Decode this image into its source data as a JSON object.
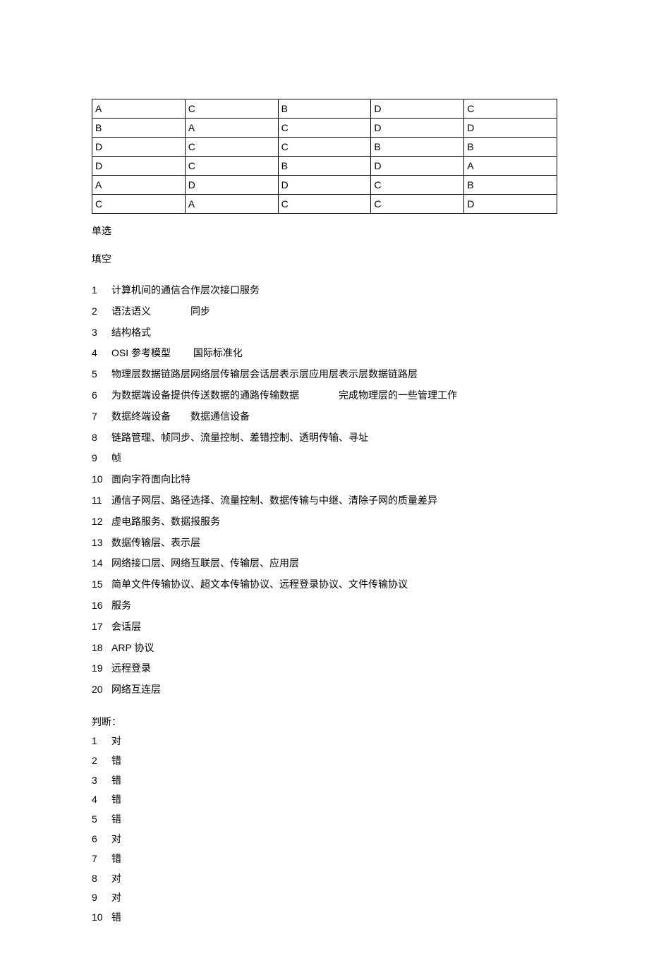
{
  "table": {
    "rows": [
      [
        "A",
        "C",
        "B",
        "D",
        "C"
      ],
      [
        "B",
        "A",
        "C",
        "D",
        "D"
      ],
      [
        "D",
        "C",
        "C",
        "B",
        "B"
      ],
      [
        "D",
        "C",
        "B",
        "D",
        "A"
      ],
      [
        "A",
        "D",
        "D",
        "C",
        "B"
      ],
      [
        "C",
        "A",
        "C",
        "C",
        "D"
      ]
    ]
  },
  "sections": {
    "single_choice": "单选",
    "fill_blank": "填空",
    "judge": "判断："
  },
  "fill": [
    {
      "num": "1",
      "text": "计算机间的通信合作层次接口服务"
    },
    {
      "num": "2",
      "text": "语法语义　　　　同步"
    },
    {
      "num": "3",
      "text": "结构格式"
    },
    {
      "num": "4",
      "text": "OSI 参考模型　　 国际标准化"
    },
    {
      "num": "5",
      "text": "物理层数据链路层网络层传输层会话层表示层应用层表示层数据链路层"
    },
    {
      "num": "6",
      "text": "为数据端设备提供传送数据的通路传输数据　　　　完成物理层的一些管理工作"
    },
    {
      "num": "7",
      "text": "数据终端设备　　数据通信设备"
    },
    {
      "num": "8",
      "text": "链路管理、帧同步、流量控制、差错控制、透明传输、寻址"
    },
    {
      "num": "9",
      "text": "帧"
    },
    {
      "num": "10",
      "text": "面向字符面向比特"
    },
    {
      "num": "11",
      "text": "通信子网层、路径选择、流量控制、数据传输与中继、清除子网的质量差异"
    },
    {
      "num": "12",
      "text": "虚电路服务、数据报服务"
    },
    {
      "num": "13",
      "text": "数据传输层、表示层"
    },
    {
      "num": "14",
      "text": "网络接口层、网络互联层、传输层、应用层"
    },
    {
      "num": "15",
      "text": "简单文件传输协议、超文本传输协议、远程登录协议、文件传输协议"
    },
    {
      "num": "16",
      "text": "服务"
    },
    {
      "num": "17",
      "text": " 会话层"
    },
    {
      "num": "18",
      "text": " ARP 协议"
    },
    {
      "num": "19",
      "text": "远程登录"
    },
    {
      "num": "20",
      "text": "网络互连层"
    }
  ],
  "judge": [
    {
      "num": "1",
      "text": "对"
    },
    {
      "num": "2",
      "text": "错"
    },
    {
      "num": "3",
      "text": "错"
    },
    {
      "num": "4",
      "text": "错"
    },
    {
      "num": "5",
      "text": "错"
    },
    {
      "num": "6",
      "text": "对"
    },
    {
      "num": "7",
      "text": "错"
    },
    {
      "num": "8",
      "text": "对"
    },
    {
      "num": "9",
      "text": "对"
    },
    {
      "num": "10",
      "text": "错"
    }
  ]
}
